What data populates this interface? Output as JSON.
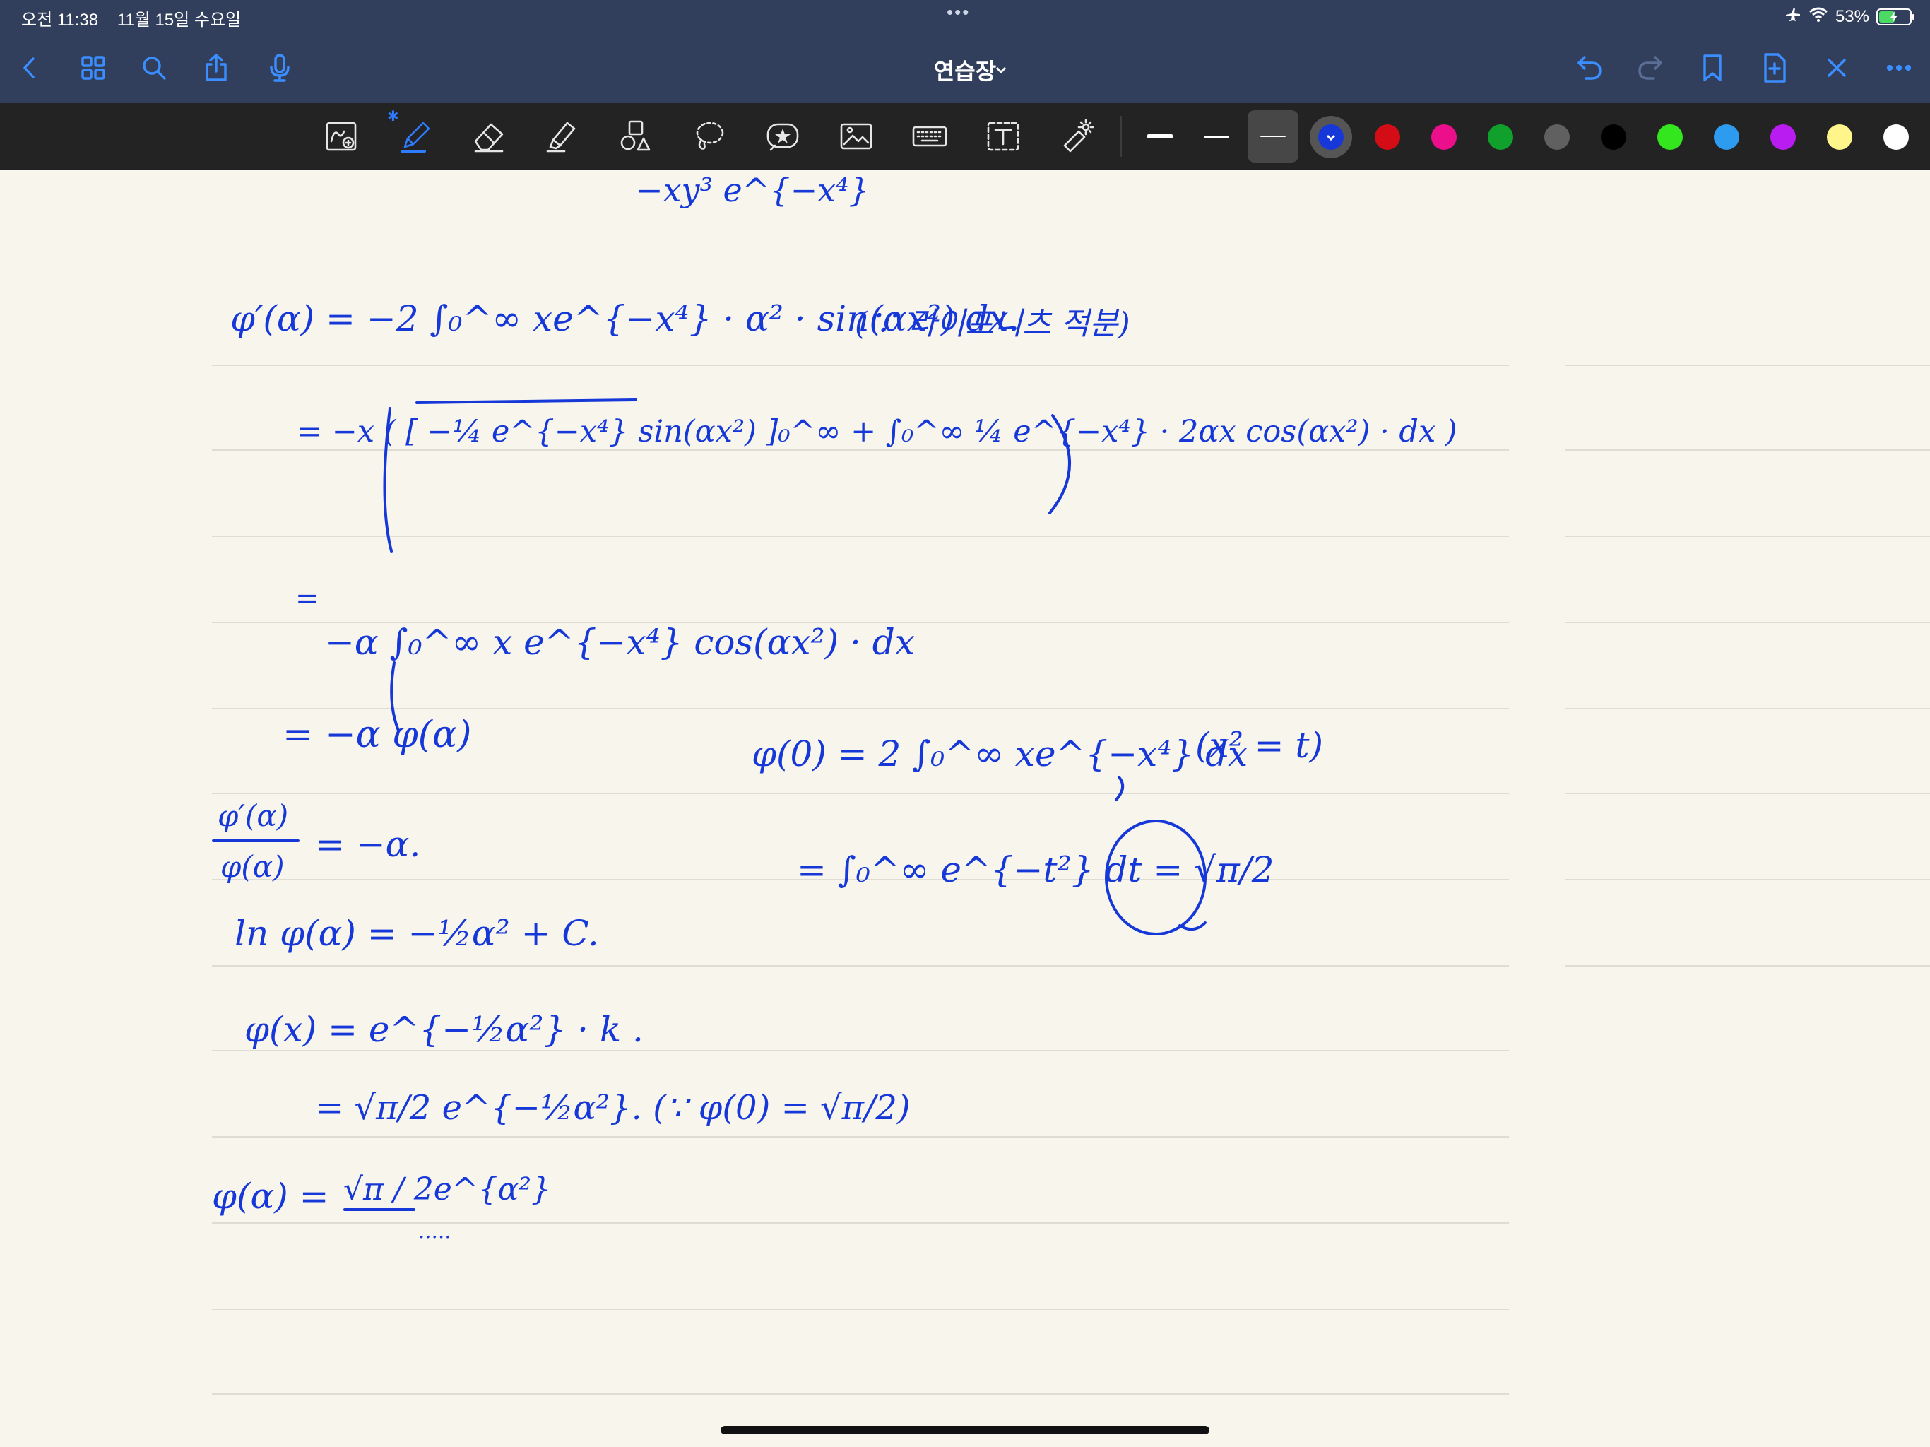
{
  "status_bar": {
    "time": "오전 11:38",
    "date": "11월 15일 수요일",
    "dots": "•••",
    "battery_percent": "53%",
    "battery_level": 0.53,
    "charging": true
  },
  "nav": {
    "title": "연습장",
    "left_icons": [
      "back-chevron-icon",
      "grid-icon",
      "search-icon",
      "share-icon",
      "microphone-icon"
    ],
    "right_icons": [
      "undo-icon",
      "redo-icon",
      "bookmark-icon",
      "add-page-icon",
      "close-icon",
      "more-icon"
    ]
  },
  "toolbar": {
    "tools": [
      "zoom-window-icon",
      "pen-icon",
      "eraser-icon",
      "highlighter-icon",
      "shapes-icon",
      "lasso-icon",
      "elements-icon",
      "image-icon",
      "camera-keyboard-icon",
      "text-box-icon",
      "laser-pointer-icon"
    ],
    "active_tool": "pen-icon",
    "stroke_widths": [
      "thick",
      "medium",
      "thin"
    ],
    "selected_stroke": "thin",
    "colors": [
      "#1638d8",
      "#d40c16",
      "#ec0f8c",
      "#10a02c",
      "#606060",
      "#000000",
      "#33e61e",
      "#2d9bf0",
      "#b81cf0",
      "#fff58a",
      "#ffffff"
    ],
    "selected_color": "#1638d8"
  },
  "note": {
    "paper_color": "#f8f6ec",
    "ink_color": "#1638d8",
    "lines": {
      "l0": "−xy³ e^{−x⁴}",
      "l1": "φ′(α) = −2 ∫₀^∞ xe^{−x⁴} · α² · sin(αx²) dx.",
      "l1_note": "(∵ 라이프니츠 적분)",
      "l2": "= −x ( [ −¼ e^{−x⁴} sin(αx²) ]₀^∞ + ∫₀^∞ ¼ e^{−x⁴} · 2αx cos(αx²) · dx )",
      "l3_eq": "=",
      "l3": "−α ∫₀^∞ x e^{−x⁴} cos(αx²) · dx",
      "l4": "= −α φ(α)",
      "l5_num": "φ′(α)",
      "l5_den": "φ(α)",
      "l5_rhs": "= −α.",
      "l6": "ln φ(α) = −½α² + C.",
      "l7": "φ(x) = e^{−½α²} · k   .",
      "l8": "= √π/2 e^{−½α²}.   (∵ φ(0) = √π/2)",
      "l9_lhs": "φ(α) =",
      "l9_frac": "√π / 2e^{α²}",
      "l9_tail": "‥…",
      "r1": "φ(0) = 2 ∫₀^∞ xe^{−x⁴} dx",
      "r1_note": "(x² = t)",
      "r2": "= ∫₀^∞ e^{−t²} dt = √π/2"
    }
  }
}
